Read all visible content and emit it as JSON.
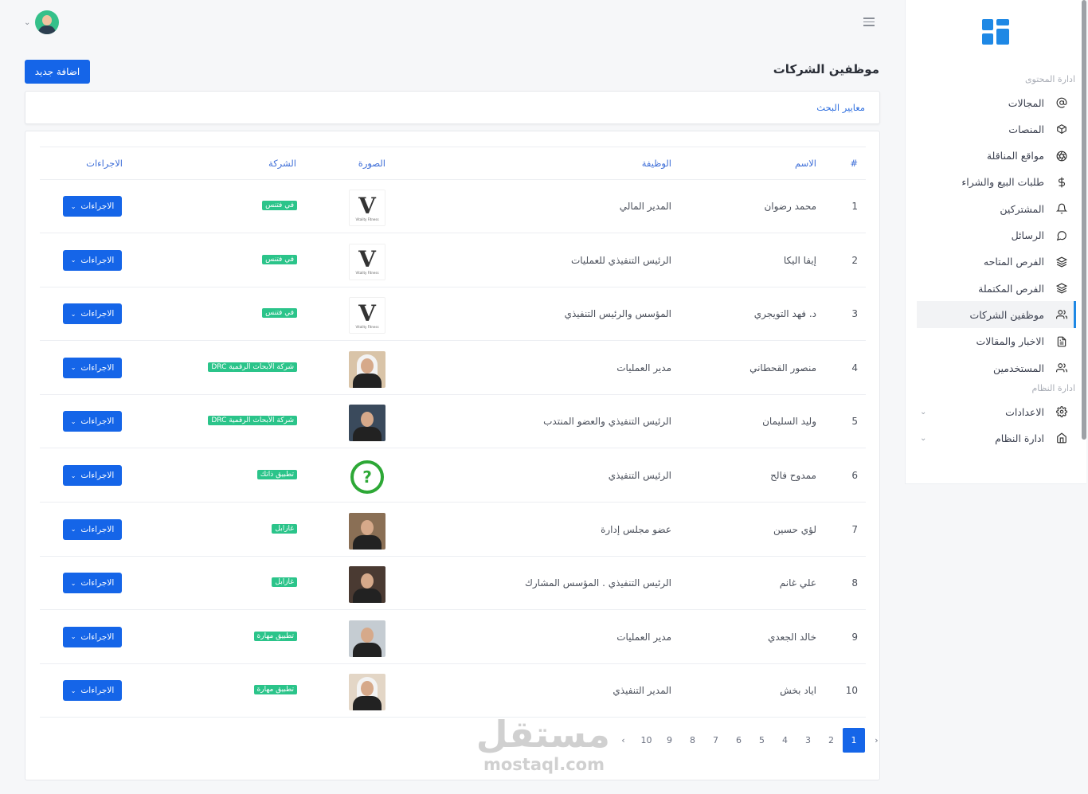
{
  "sidebar": {
    "section_content": "ادارة المحتوى",
    "section_system": "ادارة النظام",
    "items": [
      {
        "label": "المجالات",
        "icon": "at-icon"
      },
      {
        "label": "المنصات",
        "icon": "cube-icon"
      },
      {
        "label": "مواقع المناقلة",
        "icon": "aperture-icon"
      },
      {
        "label": "طلبات البيع والشراء",
        "icon": "dollar-icon"
      },
      {
        "label": "المشتركين",
        "icon": "bell-icon"
      },
      {
        "label": "الرسائل",
        "icon": "message-circle-icon"
      },
      {
        "label": "الفرص المتاحه",
        "icon": "layers-icon"
      },
      {
        "label": "الفرص المكتملة",
        "icon": "layers-icon"
      },
      {
        "label": "موظفين الشركات",
        "icon": "users-icon"
      },
      {
        "label": "الاخبار والمقالات",
        "icon": "file-text-icon"
      },
      {
        "label": "المستخدمين",
        "icon": "users-icon"
      }
    ],
    "system_items": [
      {
        "label": "الاعدادات",
        "icon": "settings-icon"
      },
      {
        "label": "ادارة النظام",
        "icon": "home-icon"
      }
    ],
    "active_index": 8
  },
  "header": {
    "title": "موظفين الشركات",
    "add_button": "اضافة جديد"
  },
  "search": {
    "label": "معايير البحث"
  },
  "table": {
    "columns": {
      "num": "#",
      "name": "الاسم",
      "job": "الوظيفة",
      "photo": "الصورة",
      "company": "الشركة",
      "actions": "الاجراءات"
    },
    "rows": [
      {
        "num": "1",
        "name": "محمد رضوان",
        "job": "المدير المالي",
        "company": "في فتنس",
        "photo": "vitality-logo",
        "action": "الاجراءات"
      },
      {
        "num": "2",
        "name": "إيفا اليكا",
        "job": "الرئيس التنفيذي للعمليات",
        "company": "في فتنس",
        "photo": "vitality-logo",
        "action": "الاجراءات"
      },
      {
        "num": "3",
        "name": "د. فهد التويجري",
        "job": "المؤسس والرئيس التنفيذي",
        "company": "في فتنس",
        "photo": "vitality-logo",
        "action": "الاجراءات"
      },
      {
        "num": "4",
        "name": "منصور القحطاني",
        "job": "مدير العمليات",
        "company": "شركة الأبحاث الرقمية DRC",
        "photo": "person-photo",
        "action": "الاجراءات"
      },
      {
        "num": "5",
        "name": "وليد السليمان",
        "job": "الرئيس التنفيذي والعضو المنتدب",
        "company": "شركة الأبحاث الرقمية DRC",
        "photo": "person-photo",
        "action": "الاجراءات"
      },
      {
        "num": "6",
        "name": "ممدوح فالح",
        "job": "الرئيس التنفيذي",
        "company": "تطبيق ذاتك",
        "photo": "green-logo",
        "action": "الاجراءات"
      },
      {
        "num": "7",
        "name": "لؤي حسين",
        "job": "عضو مجلس إدارة",
        "company": "غازابل",
        "photo": "person-photo",
        "action": "الاجراءات"
      },
      {
        "num": "8",
        "name": "علي غانم",
        "job": "الرئيس التنفيذي . المؤسس المشارك",
        "company": "غازابل",
        "photo": "person-photo",
        "action": "الاجراءات"
      },
      {
        "num": "9",
        "name": "خالد الجعدي",
        "job": "مدير العمليات",
        "company": "تطبيق مهارة",
        "photo": "person-photo",
        "action": "الاجراءات"
      },
      {
        "num": "10",
        "name": "اياد بخش",
        "job": "المدير التنفيذي",
        "company": "تطبيق مهارة",
        "photo": "person-photo",
        "action": "الاجراءات"
      }
    ]
  },
  "pagination": {
    "prev": "‹",
    "next": "›",
    "pages": [
      "1",
      "2",
      "3",
      "4",
      "5",
      "6",
      "7",
      "8",
      "9",
      "10"
    ],
    "current": "1"
  },
  "watermark": {
    "ar": "مستقل",
    "en": "mostaql.com"
  },
  "colors": {
    "primary": "#1565e8",
    "badge": "#2bc48a",
    "active_border": "#1e88e5"
  }
}
